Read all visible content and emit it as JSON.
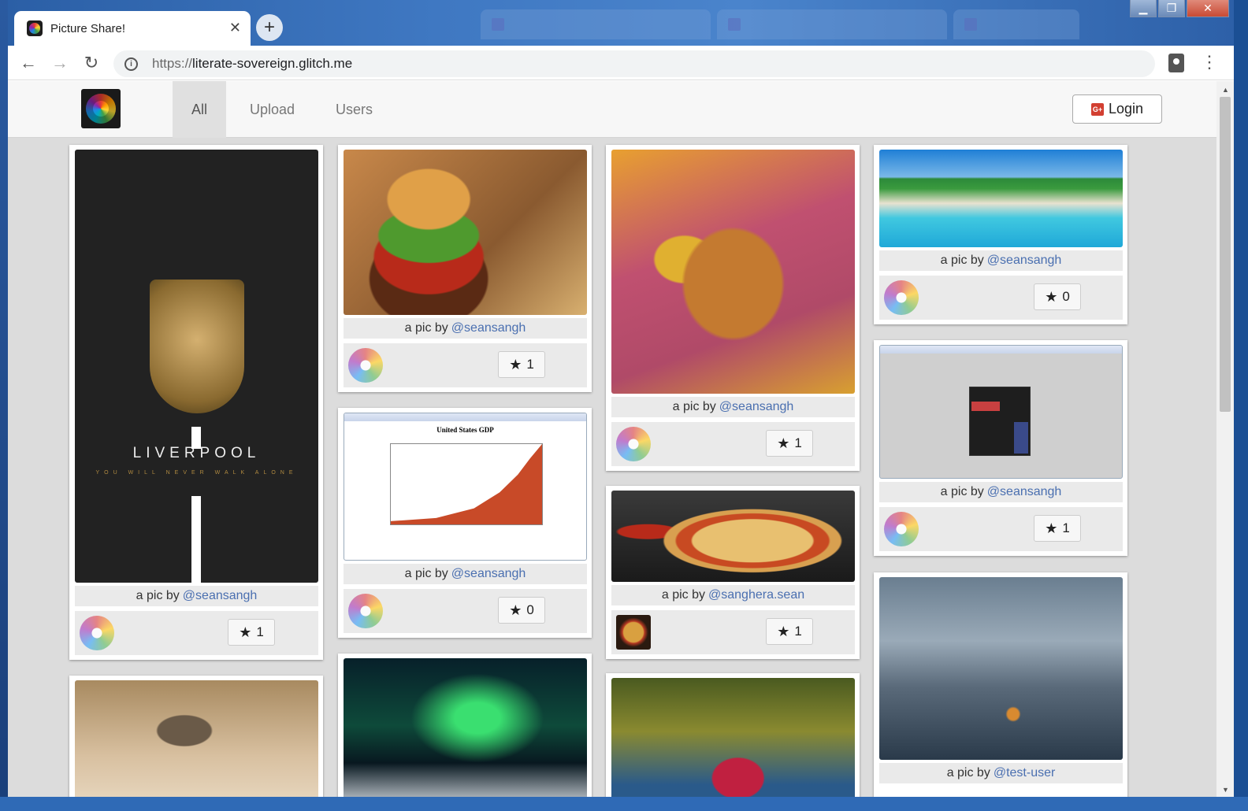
{
  "browser": {
    "tab_title": "Picture Share!",
    "url_scheme": "https://",
    "url_host": "literate-sovereign.glitch.me"
  },
  "navbar": {
    "items": [
      {
        "label": "All"
      },
      {
        "label": "Upload"
      },
      {
        "label": "Users"
      }
    ],
    "login_label": "Login"
  },
  "cards": [
    {
      "byline_prefix": "a pic by",
      "author": "@seansangh",
      "stars": "1",
      "image": "liverpool-crest",
      "texts": {
        "word": "LIVERPOOL",
        "motto": "YOU WILL NEVER WALK ALONE"
      }
    },
    {
      "byline_prefix": "a pic by",
      "author": "@seansangh",
      "stars": "1",
      "image": "burger"
    },
    {
      "byline_prefix": "a pic by",
      "author": "@seansangh",
      "stars": "1",
      "image": "shrimp"
    },
    {
      "byline_prefix": "a pic by",
      "author": "@seansangh",
      "stars": "0",
      "image": "beach"
    },
    {
      "byline_prefix": "a pic by",
      "author": "@seansangh",
      "stars": "0",
      "image": "gdp-screenshot",
      "texts": {
        "chart_title": "United States GDP"
      }
    },
    {
      "byline_prefix": "a pic by",
      "author": "@seansangh",
      "stars": "1",
      "image": "calculator-screenshot"
    },
    {
      "byline_prefix": "a pic by",
      "author": "@sanghera.sean",
      "stars": "1",
      "image": "pizza"
    },
    {
      "byline_prefix": "a pic by",
      "author": "@test-user",
      "image": "cormorant-fisherman"
    },
    {
      "image": "kitten"
    },
    {
      "image": "aurora"
    },
    {
      "image": "lotus"
    }
  ],
  "icons": {
    "star": "star-icon",
    "avatar": "aperture-avatar-icon"
  }
}
